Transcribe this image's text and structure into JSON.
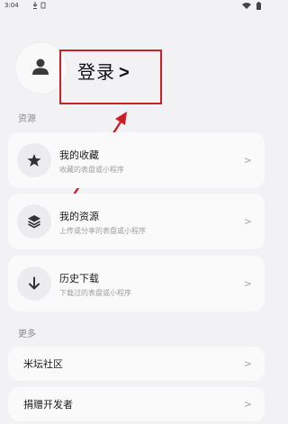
{
  "status_bar": {
    "time": "3:04",
    "icons": [
      "download-icon",
      "sim-icon",
      "wifi-icon",
      "battery-icon"
    ]
  },
  "profile": {
    "login_label": "登录",
    "login_chevron": ">",
    "avatar_icon": "user-icon",
    "annotation_color": "#cc1f27"
  },
  "sections": {
    "resources_label": "资源",
    "more_label": "更多"
  },
  "resource_items": [
    {
      "title": "我的收藏",
      "subtitle": "收藏的表盘或小程序",
      "icon": "star-icon"
    },
    {
      "title": "我的资源",
      "subtitle": "上传或分享的表盘或小程序",
      "icon": "layers-icon"
    },
    {
      "title": "历史下载",
      "subtitle": "下载过的表盘或小程序",
      "icon": "download-arrow-icon"
    }
  ],
  "more_items": [
    {
      "title": "米坛社区"
    },
    {
      "title": "捐赠开发者"
    }
  ],
  "chevron": ">"
}
